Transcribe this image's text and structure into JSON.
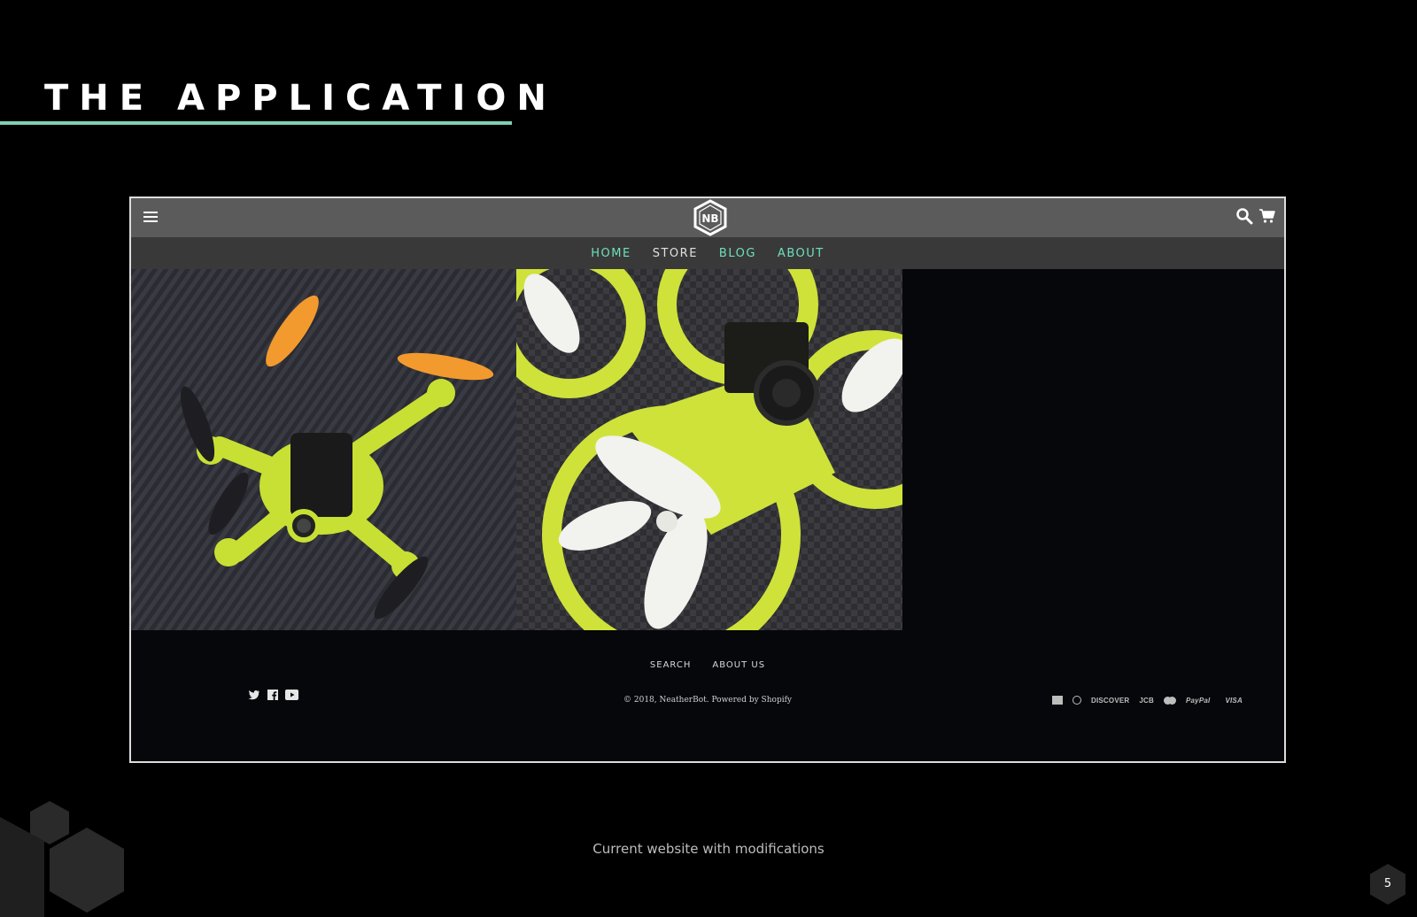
{
  "slide": {
    "title": "THE APPLICATION",
    "caption": "Current website with modifications",
    "page_number": "5",
    "accent_color": "#7fd1b4"
  },
  "site": {
    "logo_text": "NB",
    "nav": [
      {
        "label": "HOME",
        "color": "#6fe0bd"
      },
      {
        "label": "STORE",
        "color": "#e0e0e0"
      },
      {
        "label": "BLOG",
        "color": "#6fe0bd"
      },
      {
        "label": "ABOUT",
        "color": "#6fe0bd"
      }
    ],
    "header_icons": [
      "menu-icon",
      "search-icon",
      "cart-icon"
    ],
    "images": [
      {
        "name": "drone-product-photo",
        "desc_icon": "drone-photo"
      },
      {
        "name": "drone-closeup-photo",
        "desc_icon": "drone-photo"
      }
    ],
    "footer": {
      "links": [
        "SEARCH",
        "ABOUT US"
      ],
      "copyright": "© 2018, NeatherBot. Powered by Shopify",
      "social_icons": [
        "twitter-icon",
        "facebook-icon",
        "youtube-icon"
      ],
      "payments": {
        "discover": "DISCOVER",
        "jcb": "JCB",
        "paypal": "PayPal",
        "visa": "VISA"
      }
    }
  }
}
